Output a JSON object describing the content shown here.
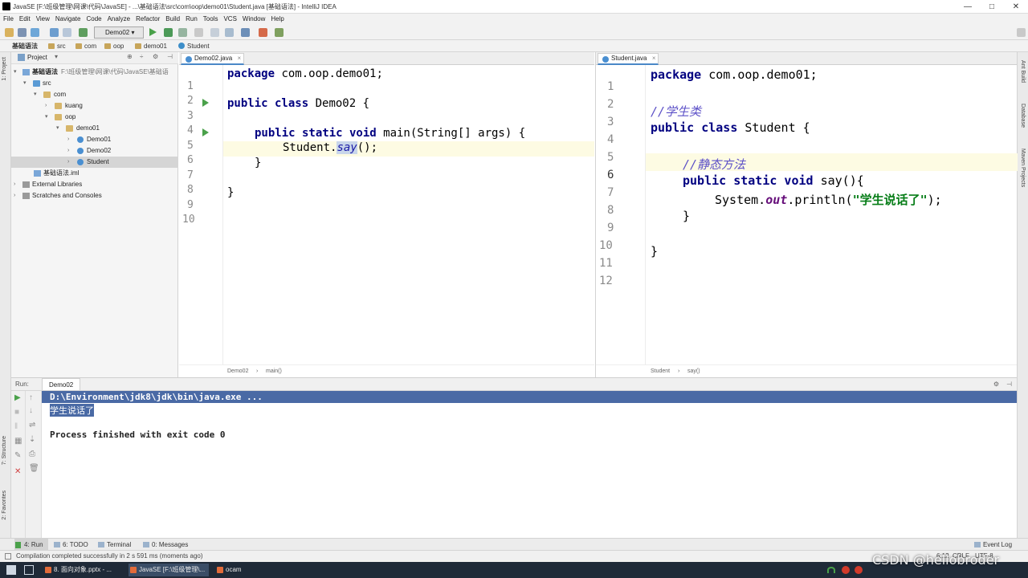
{
  "window": {
    "title": "JavaSE [F:\\班级管理\\网课\\代码\\JavaSE] - ...\\基础语法\\src\\com\\oop\\demo01\\Student.java [基础语法] - IntelliJ IDEA",
    "minimize": "—",
    "maximize": "□",
    "close": "✕"
  },
  "menu": [
    "File",
    "Edit",
    "View",
    "Navigate",
    "Code",
    "Analyze",
    "Refactor",
    "Build",
    "Run",
    "Tools",
    "VCS",
    "Window",
    "Help"
  ],
  "toolbar": {
    "run_config": "Demo02"
  },
  "breadcrumb": [
    "基础语法",
    "src",
    "com",
    "oop",
    "demo01",
    "Student"
  ],
  "project": {
    "title": "Project",
    "tree": [
      {
        "label": "基础语法",
        "path": "F:\\班级管理\\网课\\代码\\JavaSE\\基础语"
      },
      {
        "label": "src"
      },
      {
        "label": "com"
      },
      {
        "label": "kuang"
      },
      {
        "label": "oop"
      },
      {
        "label": "demo01"
      },
      {
        "label": "Demo01"
      },
      {
        "label": "Demo02"
      },
      {
        "label": "Student"
      },
      {
        "label": "基础语法.iml"
      },
      {
        "label": "External Libraries"
      },
      {
        "label": "Scratches and Consoles"
      }
    ]
  },
  "left_editor": {
    "tab": "Demo02.java",
    "lines": [
      "1",
      "2",
      "3",
      "4",
      "5",
      "6",
      "7",
      "8",
      "9",
      "10"
    ],
    "code": {
      "l1a": "package",
      "l1b": " com.oop.demo01;",
      "l3a": "public class",
      "l3b": " Demo02 {",
      "l5a": "public static void",
      "l5b": " main(String[] args) {",
      "l6a": "Student.",
      "l6b": "say",
      "l6c": "();",
      "l7": "}",
      "l9": "}"
    },
    "status": [
      "Demo02",
      "main()"
    ]
  },
  "right_editor": {
    "tab": "Student.java",
    "lines": [
      "1",
      "2",
      "3",
      "4",
      "5",
      "6",
      "7",
      "8",
      "9",
      "10",
      "11",
      "12"
    ],
    "code": {
      "l1a": "package",
      "l1b": " com.oop.demo01;",
      "l3": "//学生类",
      "l4a": "public class",
      "l4b": " Student {",
      "l6": "//静态方法",
      "l7a": "public static void",
      "l7b": " say(){",
      "l8a": "System.",
      "l8b": "out",
      "l8c": ".println(",
      "l8d": "\"学生说话了\"",
      "l8e": ");",
      "l9": "}",
      "l11": "}"
    },
    "status": [
      "Student",
      "say()"
    ]
  },
  "run_panel": {
    "label": "Run:",
    "config": "Demo02",
    "console": [
      "D:\\Environment\\jdk8\\jdk\\bin\\java.exe ...",
      "学生说话了",
      "Process finished with exit code 0"
    ]
  },
  "bottom_tabs": [
    "4: Run",
    "6: TODO",
    "Terminal",
    "0: Messages"
  ],
  "event_log": "Event Log",
  "status_message": "Compilation completed successfully in 2 s 591 ms (moments ago)",
  "status_right": [
    "6:12",
    "CRLF",
    "UTF-8"
  ],
  "side_tools": {
    "left": [
      "1: Project",
      "7: Structure",
      "2: Favorites"
    ],
    "right": [
      "Ant Build",
      "Database",
      "Maven Projects"
    ]
  },
  "taskbar": [
    "8. 面向对象.pptx - ...",
    "JavaSE [F:\\班级管理\\...",
    "ocam"
  ],
  "watermark": "CSDN @hellobroder",
  "colors": {
    "selection": "#4a6aa5",
    "run_green": "#4aa14a",
    "keyword": "#000080",
    "string": "#067d17"
  }
}
